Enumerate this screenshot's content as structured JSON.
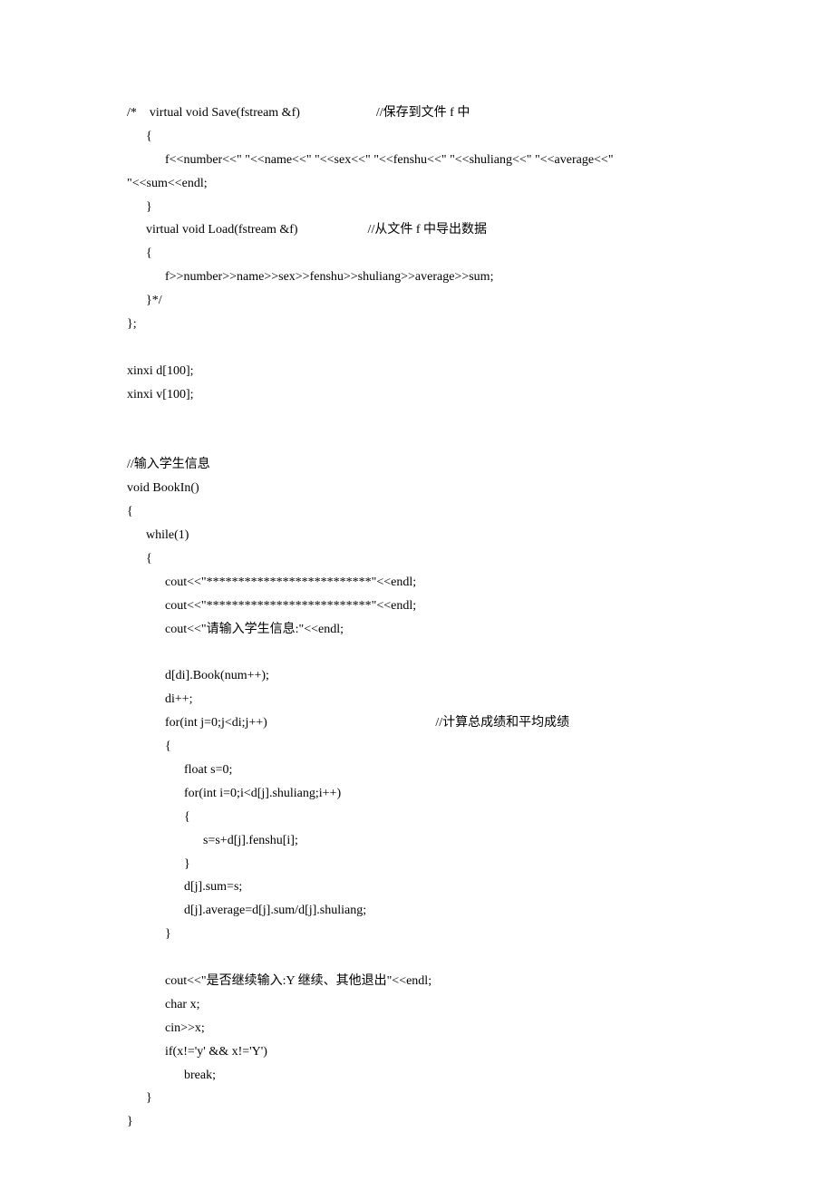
{
  "code_lines": [
    "/*    virtual void Save(fstream &f)                        //保存到文件 f 中",
    "      {",
    "            f<<number<<\" \"<<name<<\" \"<<sex<<\" \"<<fenshu<<\" \"<<shuliang<<\" \"<<average<<\" ",
    "\"<<sum<<endl;",
    "      }",
    "      virtual void Load(fstream &f)                      //从文件 f 中导出数据",
    "      {",
    "            f>>number>>name>>sex>>fenshu>>shuliang>>average>>sum;",
    "      }*/",
    "};",
    "",
    "xinxi d[100];",
    "xinxi v[100];",
    "",
    "",
    "//输入学生信息",
    "void BookIn()",
    "{",
    "      while(1)",
    "      {",
    "            cout<<\"**************************\"<<endl;",
    "            cout<<\"**************************\"<<endl;",
    "            cout<<\"请输入学生信息:\"<<endl;",
    "",
    "            d[di].Book(num++);",
    "            di++;",
    "            for(int j=0;j<di;j++)                                                     //计算总成绩和平均成绩",
    "            {",
    "                  float s=0;",
    "                  for(int i=0;i<d[j].shuliang;i++)",
    "                  {",
    "                        s=s+d[j].fenshu[i];",
    "                  }",
    "                  d[j].sum=s;",
    "                  d[j].average=d[j].sum/d[j].shuliang;",
    "            }",
    "",
    "            cout<<\"是否继续输入:Y 继续、其他退出\"<<endl;",
    "            char x;",
    "            cin>>x;",
    "            if(x!='y' && x!='Y')",
    "                  break;",
    "      }",
    "}"
  ]
}
